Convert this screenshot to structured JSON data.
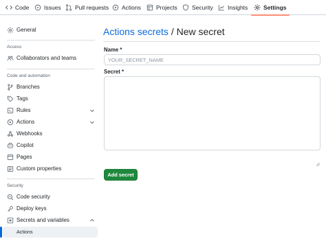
{
  "nav": {
    "tabs": [
      {
        "label": "Code",
        "icon": "code-icon"
      },
      {
        "label": "Issues",
        "icon": "issue-icon"
      },
      {
        "label": "Pull requests",
        "icon": "pull-request-icon"
      },
      {
        "label": "Actions",
        "icon": "play-icon"
      },
      {
        "label": "Projects",
        "icon": "table-icon"
      },
      {
        "label": "Security",
        "icon": "shield-icon"
      },
      {
        "label": "Insights",
        "icon": "graph-icon"
      },
      {
        "label": "Settings",
        "icon": "gear-icon",
        "active": true
      }
    ]
  },
  "sidebar": {
    "general": "General",
    "access_heading": "Access",
    "collaborators": "Collaborators and teams",
    "code_heading": "Code and automation",
    "branches": "Branches",
    "tags": "Tags",
    "rules": "Rules",
    "actions": "Actions",
    "webhooks": "Webhooks",
    "copilot": "Copilot",
    "pages": "Pages",
    "custom_properties": "Custom properties",
    "security_heading": "Security",
    "code_security": "Code security",
    "deploy_keys": "Deploy keys",
    "secrets_variables": "Secrets and variables",
    "secrets_actions": "Actions"
  },
  "main": {
    "breadcrumb_link": "Actions secrets",
    "breadcrumb_sep": "/",
    "title": "New secret",
    "name_label": "Name *",
    "name_placeholder": "YOUR_SECRET_NAME",
    "secret_label": "Secret *",
    "secret_value": "",
    "add_button": "Add secret"
  },
  "colors": {
    "accent": "#0969da",
    "primary_button": "#1f883d",
    "active_tab_underline": "#fd8c73"
  }
}
